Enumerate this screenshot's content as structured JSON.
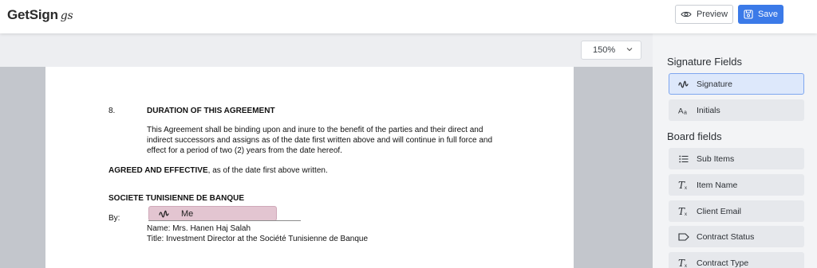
{
  "header": {
    "logo_text": "GetSign",
    "logo_mark": "gs",
    "preview_label": "Preview",
    "save_label": "Save",
    "preview_icon": "eye-icon",
    "save_icon": "save-icon"
  },
  "toolbar": {
    "zoom_value": "150%"
  },
  "document": {
    "section_number": "8.",
    "section_title": "DURATION OF THIS AGREEMENT",
    "paragraph_lines": [
      "This Agreement shall be binding upon and inure to the benefit of the parties and their direct and",
      "indirect successors and assigns as of the date first written above and will continue in full force and",
      "effect for a period of two (2) years from the date hereof."
    ],
    "agreed_bold": "AGREED AND EFFECTIVE",
    "agreed_rest": ", as of the date first above written.",
    "company": "SOCIETE TUNISIENNE DE BANQUE",
    "by_label": "By:",
    "signature_field_label": "Me",
    "name_line": "Name:  Mrs. Hanen Haj Salah",
    "title_line": "Title: Investment Director at the Société Tunisienne de Banque"
  },
  "sidebar": {
    "signature_heading": "Signature Fields",
    "signature_fields": [
      {
        "label": "Signature",
        "icon": "signature-icon",
        "active": true
      },
      {
        "label": "Initials",
        "icon": "initials-icon",
        "active": false
      }
    ],
    "board_heading": "Board fields",
    "board_fields": [
      {
        "label": "Sub Items",
        "icon": "list-icon"
      },
      {
        "label": "Item Name",
        "icon": "text-format-icon"
      },
      {
        "label": "Client Email",
        "icon": "text-format-icon"
      },
      {
        "label": "Contract Status",
        "icon": "tag-icon"
      },
      {
        "label": "Contract Type",
        "icon": "text-format-icon"
      }
    ]
  },
  "colors": {
    "accent": "#3b7ae8",
    "signature_field_bg": "#e3c5d1",
    "active_item_bg": "#dde8fb"
  }
}
